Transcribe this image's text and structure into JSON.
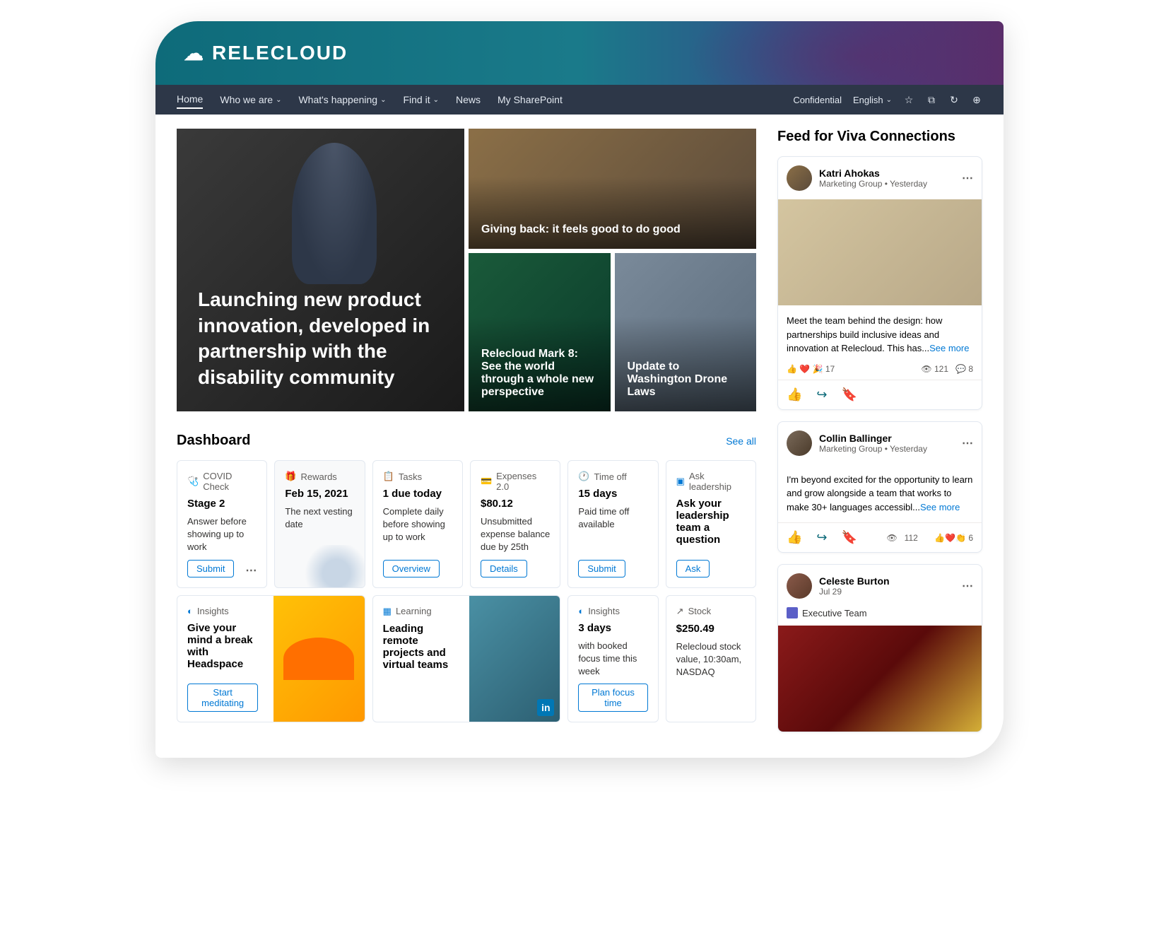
{
  "brand": "RELECLOUD",
  "nav": {
    "items": [
      "Home",
      "Who we are",
      "What's happening",
      "Find it",
      "News",
      "My SharePoint"
    ],
    "right": {
      "confidential": "Confidential",
      "language": "English"
    }
  },
  "hero": {
    "main": "Launching new product innovation, developed in partnership with the disability community",
    "tile1": "Giving back: it feels good to do good",
    "tile2": "Relecloud Mark 8: See the world through a whole new perspective",
    "tile3": "Update to Washington Drone Laws"
  },
  "dashboard": {
    "title": "Dashboard",
    "see_all": "See all",
    "cards": {
      "covid": {
        "label": "COVID Check",
        "title": "Stage 2",
        "body": "Answer before showing up to work",
        "btn": "Submit"
      },
      "rewards": {
        "label": "Rewards",
        "title": "Feb 15, 2021",
        "body": "The next vesting date"
      },
      "tasks": {
        "label": "Tasks",
        "title": "1 due today",
        "body": "Complete daily before showing up to work",
        "btn": "Overview"
      },
      "expenses": {
        "label": "Expenses 2.0",
        "title": "$80.12",
        "body": "Unsubmitted expense balance due by 25th",
        "btn": "Details"
      },
      "timeoff": {
        "label": "Time off",
        "title": "15 days",
        "body": "Paid time off available",
        "btn": "Submit"
      },
      "ask": {
        "label": "Ask leadership",
        "title": "Ask your leadership team a question",
        "btn": "Ask"
      },
      "insights1": {
        "label": "Insights",
        "title": "Give your mind a break with Headspace",
        "btn": "Start meditating"
      },
      "learning": {
        "label": "Learning",
        "title": "Leading remote projects and virtual teams"
      },
      "insights2": {
        "label": "Insights",
        "title": "3 days",
        "body": "with booked focus time this week",
        "btn": "Plan focus time"
      },
      "stock": {
        "label": "Stock",
        "title": "$250.49",
        "body": "Relecloud stock value, 10:30am, NASDAQ"
      }
    }
  },
  "feed": {
    "title": "Feed for Viva Connections",
    "posts": [
      {
        "name": "Katri Ahokas",
        "sub": "Marketing Group • Yesterday",
        "text": "Meet the team behind the design: how partnerships build inclusive ideas and innovation at Relecloud. This has...",
        "see_more": "See more",
        "reactions": "👍 ❤️ 🎉 17",
        "views": "121",
        "comments": "8"
      },
      {
        "name": "Collin Ballinger",
        "sub": "Marketing Group • Yesterday",
        "text": "I'm beyond excited for the opportunity to learn and grow alongside a team that works to make 30+ languages accessibl...",
        "see_more": "See more",
        "views": "112",
        "reactions": "👍❤️👏 6"
      },
      {
        "name": "Celeste Burton",
        "sub": "Jul 29",
        "tag": "Executive Team"
      }
    ]
  }
}
